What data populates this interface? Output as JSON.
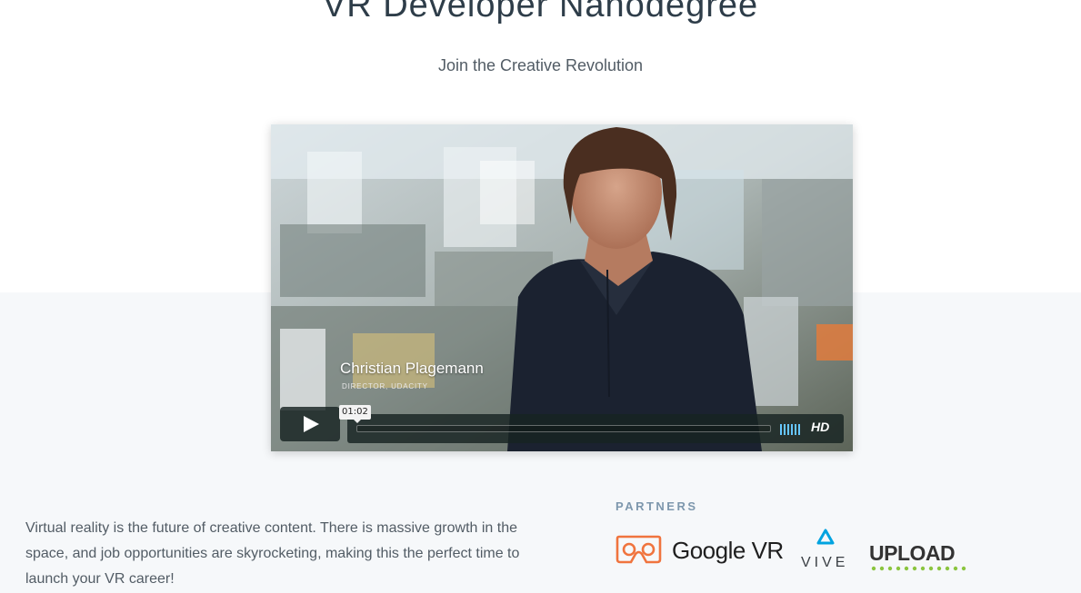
{
  "hero": {
    "title": "VR Developer Nanodegree",
    "subtitle": "Join the Creative Revolution"
  },
  "video": {
    "speaker_name": "Christian Plagemann",
    "speaker_role": "DIRECTOR, UDACITY",
    "hover_time": "01:02",
    "quality_label": "HD",
    "play_icon": "play-icon",
    "volume_icon": "volume-bars-icon"
  },
  "intro": {
    "text": "Virtual reality is the future of creative content. There is massive growth in the space, and job opportunities are skyrocketing, making this the perfect time to launch your VR career!"
  },
  "partners": {
    "label": "PARTNERS",
    "logos": [
      {
        "name": "Google VR",
        "icon": "cardboard-icon",
        "accent": "#f0743e"
      },
      {
        "name": "VIVE",
        "icon": "vive-icon",
        "accent": "#00a3e0"
      },
      {
        "name": "UPLOAD",
        "icon": "upload-logo",
        "accent": "#8bc53f"
      }
    ]
  },
  "colors": {
    "band_background": "#f6f8fa",
    "heading": "#2e3d49",
    "body_text": "#525c65",
    "partners_label": "#7d97ad",
    "player_accent": "#66c6ff"
  }
}
